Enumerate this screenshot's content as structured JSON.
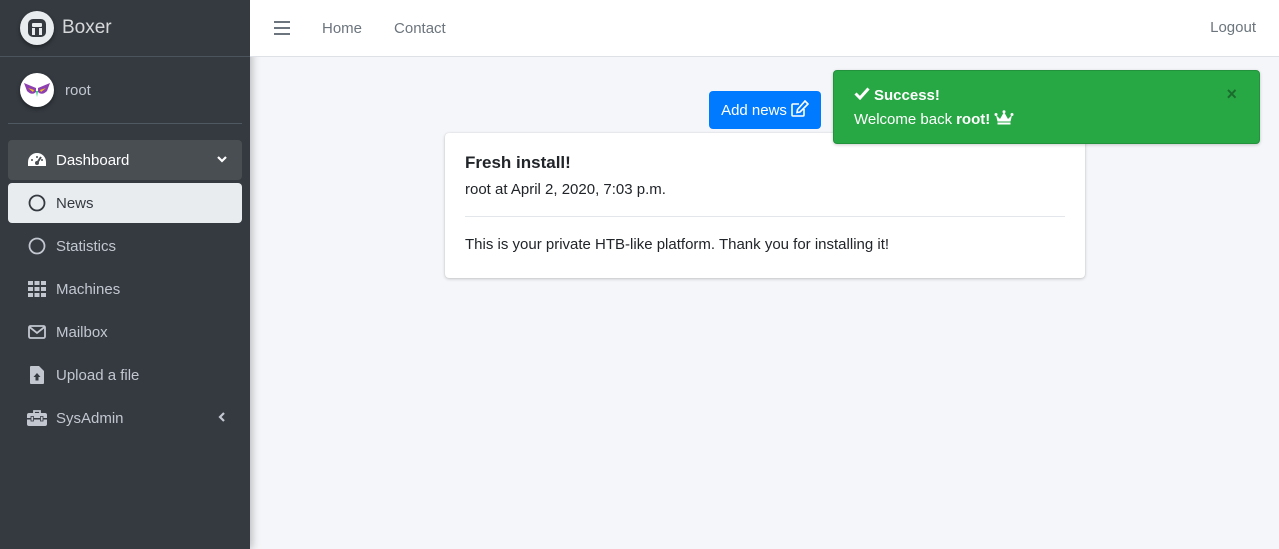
{
  "brand": {
    "name": "Boxer",
    "icon": "brand-logo-icon"
  },
  "user": {
    "name": "root"
  },
  "sidebar": {
    "items": [
      {
        "label": "Dashboard",
        "icon": "tachometer-icon"
      },
      {
        "label": "News",
        "icon": "circle-icon"
      },
      {
        "label": "Statistics",
        "icon": "circle-icon"
      },
      {
        "label": "Machines",
        "icon": "grid-icon"
      },
      {
        "label": "Mailbox",
        "icon": "envelope-icon"
      },
      {
        "label": "Upload a file",
        "icon": "file-upload-icon"
      },
      {
        "label": "SysAdmin",
        "icon": "toolbox-icon"
      }
    ]
  },
  "topbar": {
    "home": "Home",
    "contact": "Contact",
    "logout": "Logout"
  },
  "main": {
    "add_news_label": "Add news",
    "post": {
      "title": "Fresh install!",
      "meta": "root at April 2, 2020, 7:03 p.m.",
      "body": "This is your private HTB-like platform. Thank you for installing it!"
    }
  },
  "toast": {
    "title": "Success!",
    "message_prefix": "Welcome back",
    "message_user": "root!",
    "close": "×"
  },
  "colors": {
    "sidebar_bg": "#343a40",
    "primary": "#007bff",
    "success": "#28a745",
    "content_bg": "#f4f6f9"
  }
}
